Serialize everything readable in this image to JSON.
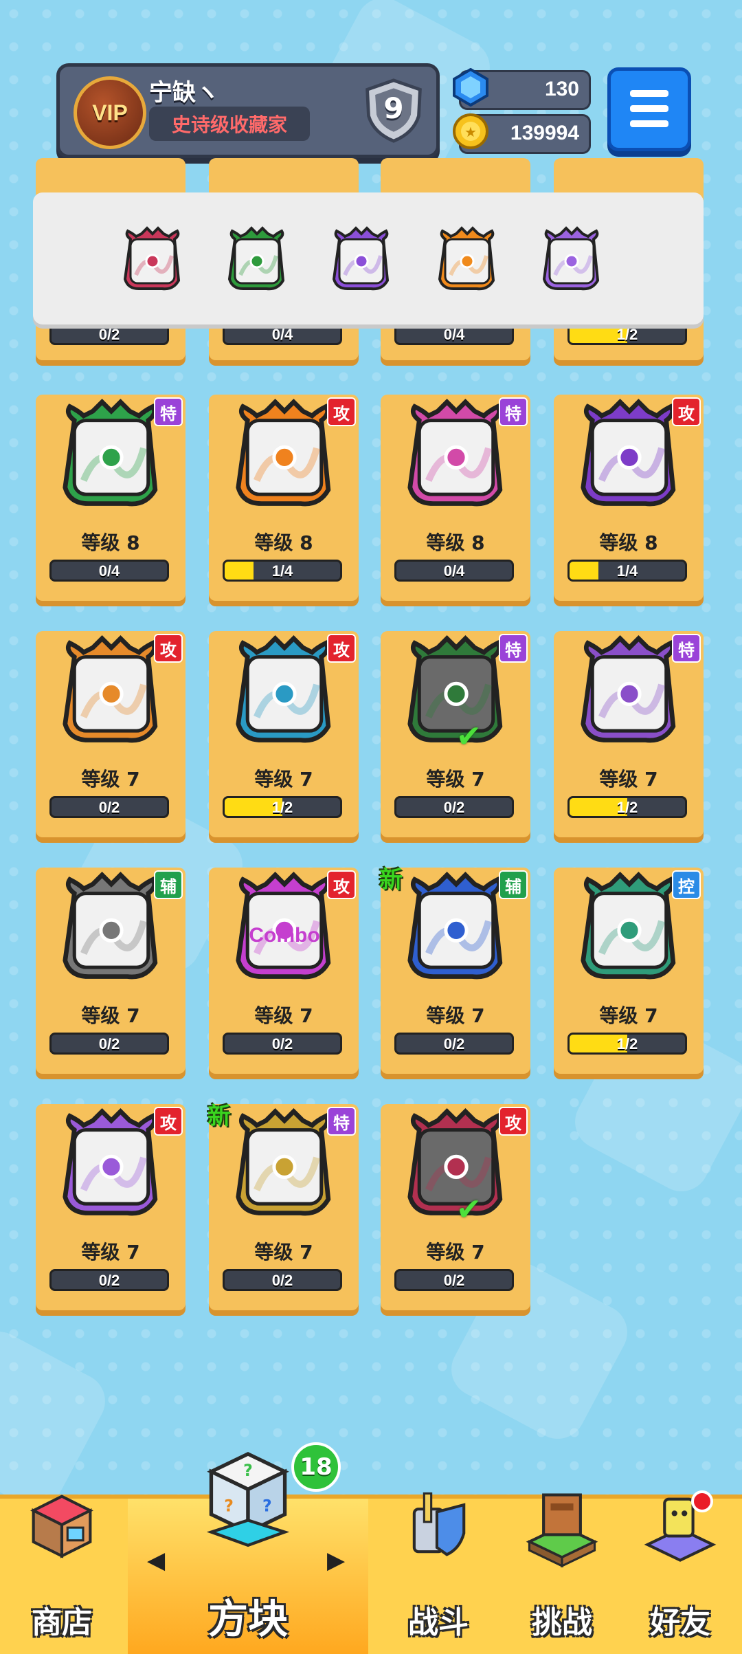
{
  "profile": {
    "vip_label": "VIP",
    "name": "宁缺ヽ",
    "title": "史诗级收藏家",
    "rank": "9"
  },
  "currency": {
    "gems": "130",
    "coins": "139994"
  },
  "equipped": [
    {
      "icon": "saw-blade-dice-icon",
      "color": "#c9375a"
    },
    {
      "icon": "vine-dice-icon",
      "color": "#2e9a3c"
    },
    {
      "icon": "spiral-dice-icon",
      "color": "#8b4fd8"
    },
    {
      "icon": "infinity-dice-icon",
      "color": "#f08a1c"
    },
    {
      "icon": "crack-dice-icon",
      "color": "#9b63e0"
    }
  ],
  "partial_row": [
    {
      "progress": "0/2",
      "fill": 0
    },
    {
      "progress": "0/4",
      "fill": 0
    },
    {
      "progress": "0/4",
      "fill": 0
    },
    {
      "progress": "1/2",
      "fill": 0.5
    }
  ],
  "cards": [
    {
      "tag": "特",
      "tag_type": "sp",
      "icon": "star-circle-dice-icon",
      "color": "#2ea24a",
      "level": "等级 8",
      "progress": "0/4",
      "fill": 0
    },
    {
      "tag": "攻",
      "tag_type": "atk",
      "icon": "fire-dice-icon",
      "color": "#f0821e",
      "level": "等级 8",
      "progress": "1/4",
      "fill": 0.25
    },
    {
      "tag": "特",
      "tag_type": "sp",
      "icon": "poison-syringe-dice-icon",
      "color": "#d24aa8",
      "level": "等级 8",
      "progress": "0/4",
      "fill": 0
    },
    {
      "tag": "攻",
      "tag_type": "atk",
      "icon": "atom-dice-icon",
      "color": "#7d3cc8",
      "level": "等级 8",
      "progress": "1/4",
      "fill": 0.25
    },
    {
      "tag": "攻",
      "tag_type": "atk",
      "icon": "gun-dice-icon",
      "color": "#e68a2a",
      "level": "等级 7",
      "progress": "0/2",
      "fill": 0
    },
    {
      "tag": "攻",
      "tag_type": "atk",
      "icon": "wind-dice-icon",
      "color": "#2a9ac4",
      "level": "等级 7",
      "progress": "1/2",
      "fill": 0.5
    },
    {
      "tag": "特",
      "tag_type": "sp",
      "icon": "thorn-dice-icon",
      "color": "#2f7a3a",
      "level": "等级 7",
      "progress": "0/2",
      "fill": 0,
      "check": true,
      "dark": true
    },
    {
      "tag": "特",
      "tag_type": "sp",
      "icon": "mist-dice-icon",
      "color": "#8a4fc9",
      "level": "等级 7",
      "progress": "1/2",
      "fill": 0.5
    },
    {
      "tag": "辅",
      "tag_type": "sup",
      "icon": "clock-dice-icon",
      "color": "#777777",
      "level": "等级 7",
      "progress": "0/2",
      "fill": 0
    },
    {
      "tag": "攻",
      "tag_type": "atk",
      "icon": "combo-dice-icon",
      "color": "#c53fcf",
      "level": "等级 7",
      "progress": "0/2",
      "fill": 0,
      "text": "Combo"
    },
    {
      "tag": "辅",
      "tag_type": "sup",
      "icon": "moon-dice-icon",
      "color": "#2f5fd0",
      "level": "等级 7",
      "progress": "0/2",
      "fill": 0,
      "new": "新"
    },
    {
      "tag": "控",
      "tag_type": "ctl",
      "icon": "wave-dice-icon",
      "color": "#2f9c7a",
      "level": "等级 7",
      "progress": "1/2",
      "fill": 0.5
    },
    {
      "tag": "攻",
      "tag_type": "atk",
      "icon": "star-dice-icon",
      "color": "#9a5ad9",
      "level": "等级 7",
      "progress": "0/2",
      "fill": 0
    },
    {
      "tag": "特",
      "tag_type": "sp",
      "icon": "sun-crest-dice-icon",
      "color": "#c9a233",
      "level": "等级 7",
      "progress": "0/2",
      "fill": 0,
      "new": "新"
    },
    {
      "tag": "攻",
      "tag_type": "atk",
      "icon": "blackhole-dice-icon",
      "color": "#b23050",
      "level": "等级 7",
      "progress": "0/2",
      "fill": 0,
      "check": true,
      "dark": true
    }
  ],
  "nav": {
    "shop": "商店",
    "dice": "方块",
    "dice_badge": "18",
    "battle": "战斗",
    "challenge": "挑战",
    "friends": "好友"
  }
}
